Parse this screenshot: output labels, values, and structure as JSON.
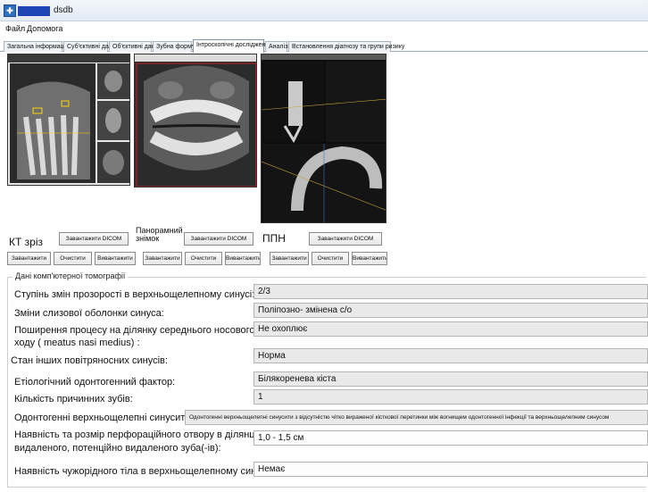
{
  "window": {
    "title": "dsdb"
  },
  "menu": {
    "file": "Файл",
    "help": "Допомога"
  },
  "tabs": [
    "Загальна інформація",
    "Суб'єктивні дані",
    "Об'єктивні дані",
    "Зубна формула",
    "Інтроскопічні дослідження",
    "Аналізи",
    "Встановлення діагнозу та групи ризику"
  ],
  "imaging": {
    "ct": {
      "label": "КТ зріз",
      "upload": "Завантажити DICOM",
      "load": "Завантажити",
      "clear": "Очистити",
      "unload": "Вивантажити"
    },
    "panoramic": {
      "label": "Панорамний знімок",
      "upload": "Завантажити DICOM",
      "load": "Завантажити",
      "clear": "Очистити",
      "unload": "Вивантажити"
    },
    "ppn": {
      "label": "ППН",
      "upload": "Завантажити DICOM",
      "load": "Завантажити",
      "clear": "Очистити",
      "unload": "Вивантажити"
    }
  },
  "ct_data": {
    "legend": "Дані комп'ютерної томографії",
    "fields": [
      {
        "label": "Ступінь змін прозорості в верхньощелепному синусі:",
        "value": "2/3"
      },
      {
        "label": "Зміни  слизової оболонки синуса:",
        "value": "Поліпозно- змінена с/о"
      },
      {
        "label": "Поширення процесу на ділянку середнього носового",
        "label2": "ходу ( meatus nasi medius) :",
        "value": "Не охоплює"
      },
      {
        "label": "Стан інших повітряносних синусів:",
        "value": "Норма"
      },
      {
        "label": "Етіологічний одонтогенний фактор:",
        "value": "Білякоренева кіста"
      },
      {
        "label": "Кількість  причинних зубів:",
        "value": "1"
      },
      {
        "label": "Одонтогенні верхньощелепні синусити:",
        "value": "Одонтогенні верхньощелепні синусити  з відсутністю чітко вираженої кісткової перетинки між вогнищем одонтогенної інфекції та верхньощелепним синусом"
      },
      {
        "label": "Наявність та розмір перфораційного отвору в ділянці",
        "label2": "видаленого, потенційно видаленого зуба(-ів):",
        "value": "1,0 - 1,5 см"
      },
      {
        "label": "Наявність чужорідного тіла в верхньощелепному синусі:",
        "value": "Немає"
      }
    ]
  }
}
